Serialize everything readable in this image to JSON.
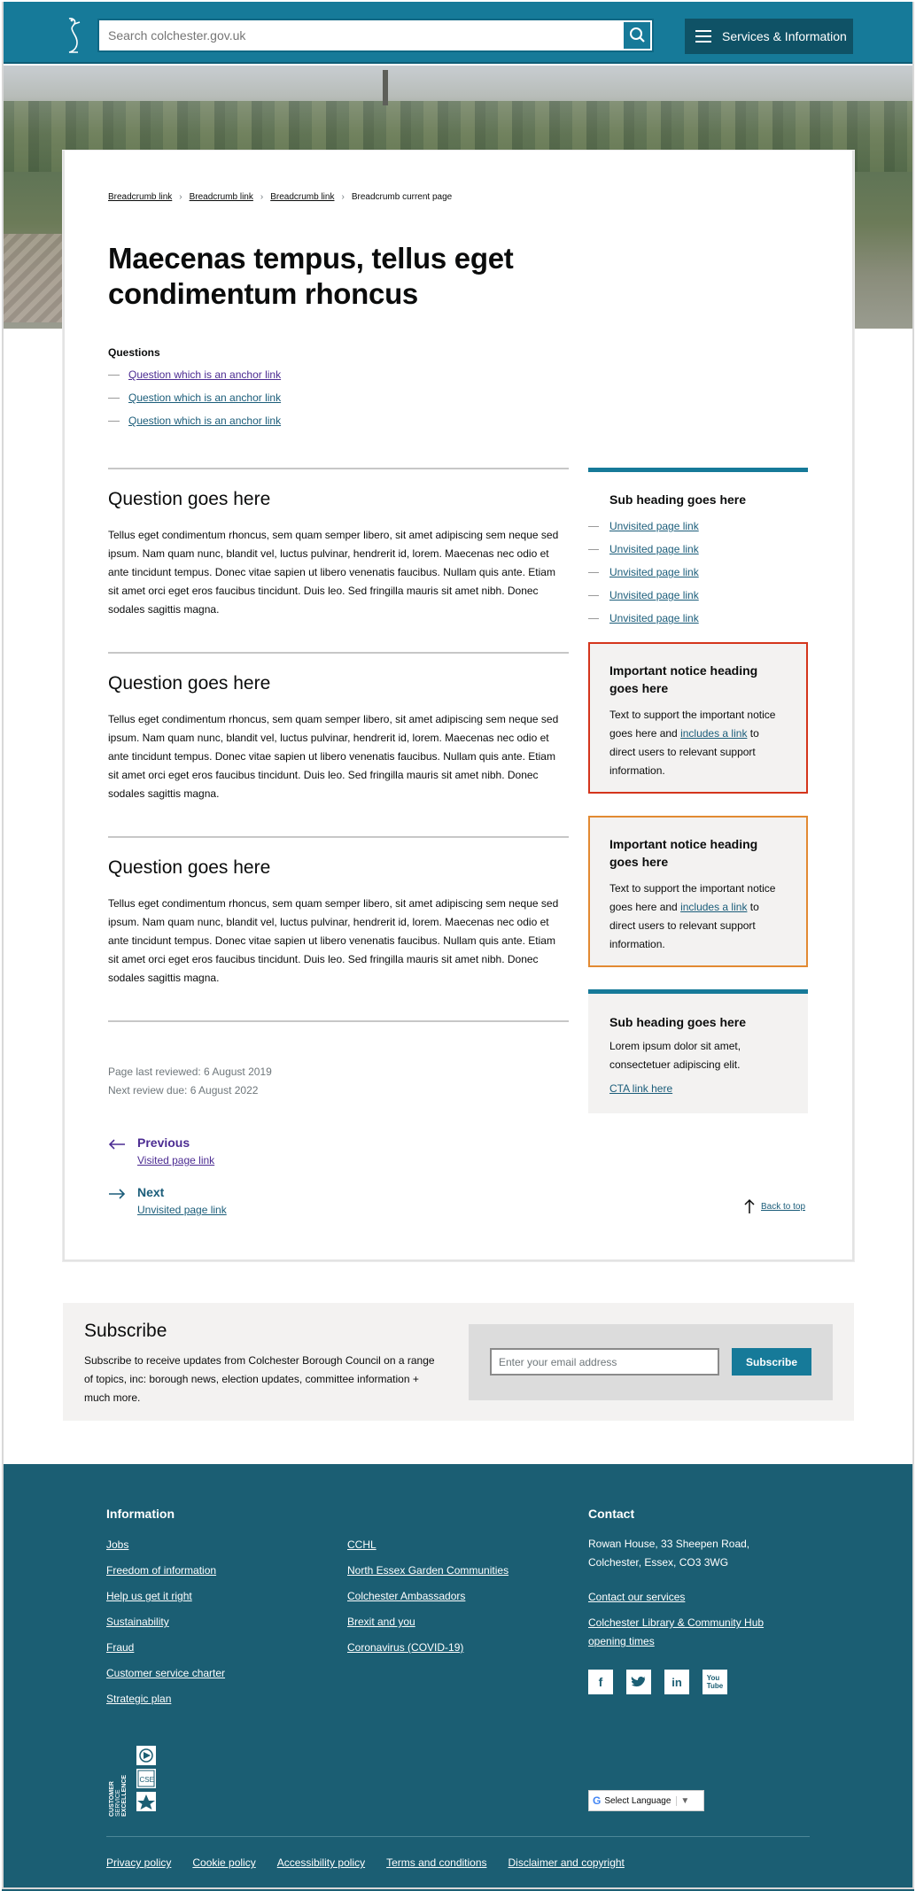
{
  "header": {
    "search_placeholder": "Search colchester.gov.uk",
    "menu_label": "Services & Information"
  },
  "breadcrumbs": [
    "Breadcrumb link",
    "Breadcrumb link",
    "Breadcrumb link"
  ],
  "breadcrumb_current": "Breadcrumb current page",
  "page_title": "Maecenas tempus, tellus eget condimentum rhoncus",
  "questions": {
    "label": "Questions",
    "links": [
      "Question which is an anchor link",
      "Question which is an anchor link",
      "Question which is an anchor link"
    ]
  },
  "sections": [
    {
      "heading": "Question goes here",
      "body": "Tellus eget condimentum rhoncus, sem quam semper libero, sit amet adipiscing sem neque sed ipsum. Nam quam nunc, blandit vel, luctus pulvinar, hendrerit id, lorem. Maecenas nec odio et ante tincidunt tempus. Donec vitae sapien ut libero venenatis faucibus. Nullam quis ante. Etiam sit amet orci eget eros faucibus tincidunt. Duis leo. Sed fringilla mauris sit amet nibh. Donec sodales sagittis magna."
    },
    {
      "heading": "Question goes here",
      "body": "Tellus eget condimentum rhoncus, sem quam semper libero, sit amet adipiscing sem neque sed ipsum. Nam quam nunc, blandit vel, luctus pulvinar, hendrerit id, lorem. Maecenas nec odio et ante tincidunt tempus. Donec vitae sapien ut libero venenatis faucibus. Nullam quis ante. Etiam sit amet orci eget eros faucibus tincidunt. Duis leo. Sed fringilla mauris sit amet nibh. Donec sodales sagittis magna."
    },
    {
      "heading": "Question goes here",
      "body": "Tellus eget condimentum rhoncus, sem quam semper libero, sit amet adipiscing sem neque sed ipsum. Nam quam nunc, blandit vel, luctus pulvinar, hendrerit id, lorem. Maecenas nec odio et ante tincidunt tempus. Donec vitae sapien ut libero venenatis faucibus. Nullam quis ante. Etiam sit amet orci eget eros faucibus tincidunt. Duis leo. Sed fringilla mauris sit amet nibh. Donec sodales sagittis magna."
    }
  ],
  "meta": {
    "last_reviewed": "Page last reviewed: 6 August 2019",
    "next_review": "Next review due: 6 August 2022"
  },
  "pagination": {
    "prev_label": "Previous",
    "prev_link": "Visited page link",
    "next_label": "Next",
    "next_link": "Unvisited page link",
    "back_to_top": "Back to top"
  },
  "sidebar": {
    "links_heading": "Sub heading goes here",
    "links": [
      "Unvisited page link",
      "Unvisited page link",
      "Unvisited page link",
      "Unvisited page link",
      "Unvisited page link"
    ],
    "notices": [
      {
        "heading": "Important notice heading goes here",
        "text_before": "Text to support the important notice goes here and ",
        "link": "includes a link",
        "text_after": " to direct users to relevant support information."
      },
      {
        "heading": "Important notice heading goes here",
        "text_before": "Text to support the important notice goes here and ",
        "link": "includes a link",
        "text_after": " to direct users to relevant support information."
      }
    ],
    "cta": {
      "heading": "Sub heading goes here",
      "text": "Lorem ipsum dolor sit amet, consectetuer adipiscing elit.",
      "link": "CTA link here"
    }
  },
  "subscribe": {
    "heading": "Subscribe",
    "text": "Subscribe to receive updates from Colchester Borough Council on a range of topics, inc: borough news, election updates, committee information + much more.",
    "placeholder": "Enter your email address",
    "button": "Subscribe"
  },
  "footer": {
    "info_heading": "Information",
    "col1": [
      "Jobs",
      "Freedom of information",
      "Help us get it right",
      "Sustainability",
      "Fraud",
      "Customer service charter",
      "Strategic plan"
    ],
    "col2": [
      "CCHL",
      "North Essex Garden Communities",
      "Colchester Ambassadors",
      "Brexit and you",
      "Coronavirus (COVID-19)"
    ],
    "contact_heading": "Contact",
    "address": "Rowan House, 33 Sheepen Road, Colchester, Essex, CO3 3WG",
    "contact_links": [
      "Contact our services",
      "Colchester Library & Community Hub opening times"
    ],
    "social": [
      "facebook-icon",
      "twitter-icon",
      "linkedin-icon",
      "youtube-icon"
    ],
    "cse_text": "CUSTOMER SERVICE EXCELLENCE",
    "translate": "Select Language",
    "legal": [
      "Privacy policy",
      "Cookie policy",
      "Accessibility policy",
      "Terms and conditions",
      "Disclaimer and copyright"
    ]
  },
  "colors": {
    "brand": "#167a99",
    "footer": "#1b5e73",
    "link": "#1b5d7a",
    "visited": "#4c2c92",
    "notice_red": "#d4351c",
    "notice_amber": "#e28a32"
  }
}
